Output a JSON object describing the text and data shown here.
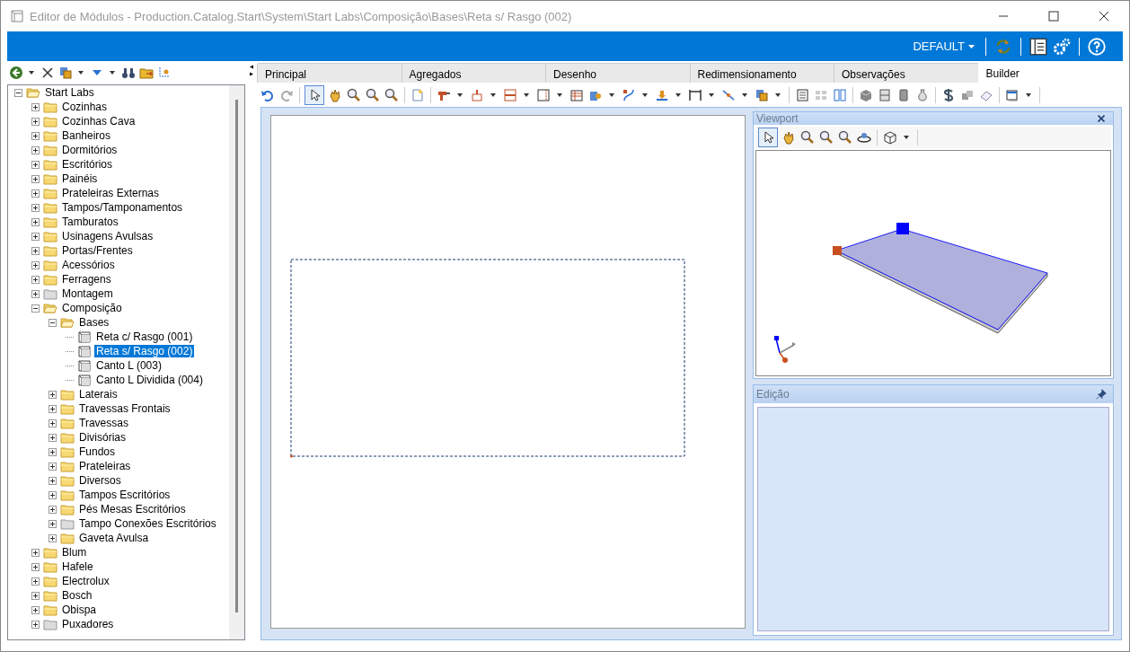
{
  "window": {
    "title": "Editor de Módulos - Production.Catalog.Start\\System\\Start Labs\\Composição\\Bases\\Reta s/ Rasgo (002)"
  },
  "header": {
    "profile": "DEFAULT"
  },
  "tree": [
    {
      "label": "Start Labs",
      "kind": "folder",
      "expanded": true,
      "selected": false,
      "children": [
        {
          "label": "Cozinhas",
          "kind": "folder",
          "expanded": false,
          "selected": false
        },
        {
          "label": "Cozinhas Cava",
          "kind": "folder",
          "expanded": false,
          "selected": false
        },
        {
          "label": "Banheiros",
          "kind": "folder",
          "expanded": false,
          "selected": false
        },
        {
          "label": "Dormitórios",
          "kind": "folder",
          "expanded": false,
          "selected": false
        },
        {
          "label": "Escritórios",
          "kind": "folder",
          "expanded": false,
          "selected": false
        },
        {
          "label": "Painéis",
          "kind": "folder",
          "expanded": false,
          "selected": false
        },
        {
          "label": "Prateleiras Externas",
          "kind": "folder",
          "expanded": false,
          "selected": false
        },
        {
          "label": "Tampos/Tamponamentos",
          "kind": "folder",
          "expanded": false,
          "selected": false
        },
        {
          "label": "Tamburatos",
          "kind": "folder",
          "expanded": false,
          "selected": false
        },
        {
          "label": "Usinagens Avulsas",
          "kind": "folder",
          "expanded": false,
          "selected": false
        },
        {
          "label": "Portas/Frentes",
          "kind": "folder",
          "expanded": false,
          "selected": false
        },
        {
          "label": "Acessórios",
          "kind": "folder",
          "expanded": false,
          "selected": false
        },
        {
          "label": "Ferragens",
          "kind": "folder",
          "expanded": false,
          "selected": false
        },
        {
          "label": "Montagem",
          "kind": "empty",
          "expanded": false,
          "selected": false
        },
        {
          "label": "Composição",
          "kind": "folder",
          "expanded": true,
          "selected": false,
          "children": [
            {
              "label": "Bases",
              "kind": "folder",
              "expanded": true,
              "selected": false,
              "children": [
                {
                  "label": "Reta c/ Rasgo (001)",
                  "kind": "module",
                  "selected": false
                },
                {
                  "label": "Reta s/ Rasgo (002)",
                  "kind": "module",
                  "selected": true
                },
                {
                  "label": "Canto L (003)",
                  "kind": "module",
                  "selected": false
                },
                {
                  "label": "Canto L Dividida (004)",
                  "kind": "module",
                  "selected": false
                }
              ]
            },
            {
              "label": "Laterais",
              "kind": "folder",
              "expanded": false,
              "selected": false
            },
            {
              "label": "Travessas Frontais",
              "kind": "folder",
              "expanded": false,
              "selected": false
            },
            {
              "label": "Travessas",
              "kind": "folder",
              "expanded": false,
              "selected": false
            },
            {
              "label": "Divisórias",
              "kind": "folder",
              "expanded": false,
              "selected": false
            },
            {
              "label": "Fundos",
              "kind": "folder",
              "expanded": false,
              "selected": false
            },
            {
              "label": "Prateleiras",
              "kind": "folder",
              "expanded": false,
              "selected": false
            },
            {
              "label": "Diversos",
              "kind": "folder",
              "expanded": false,
              "selected": false
            },
            {
              "label": "Tampos Escritórios",
              "kind": "folder",
              "expanded": false,
              "selected": false
            },
            {
              "label": "Pés Mesas Escritórios",
              "kind": "folder",
              "expanded": false,
              "selected": false
            },
            {
              "label": "Tampo Conexões Escritórios",
              "kind": "empty",
              "expanded": false,
              "selected": false
            },
            {
              "label": "Gaveta Avulsa",
              "kind": "folder",
              "expanded": false,
              "selected": false
            }
          ]
        },
        {
          "label": "Blum",
          "kind": "folder",
          "expanded": false,
          "selected": false
        },
        {
          "label": "Hafele",
          "kind": "folder",
          "expanded": false,
          "selected": false
        },
        {
          "label": "Electrolux",
          "kind": "folder",
          "expanded": false,
          "selected": false
        },
        {
          "label": "Bosch",
          "kind": "folder",
          "expanded": false,
          "selected": false
        },
        {
          "label": "Obispa",
          "kind": "folder",
          "expanded": false,
          "selected": false
        },
        {
          "label": "Puxadores",
          "kind": "empty",
          "expanded": false,
          "selected": false
        }
      ]
    }
  ],
  "tabs": [
    {
      "label": "Principal",
      "selected": false
    },
    {
      "label": "Agregados",
      "selected": false
    },
    {
      "label": "Desenho",
      "selected": false
    },
    {
      "label": "Redimensionamento",
      "selected": false
    },
    {
      "label": "Observações",
      "selected": false
    },
    {
      "label": "Builder",
      "selected": true
    }
  ],
  "viewport_panel": {
    "title": "Viewport"
  },
  "edit_panel": {
    "title": "Edição"
  }
}
